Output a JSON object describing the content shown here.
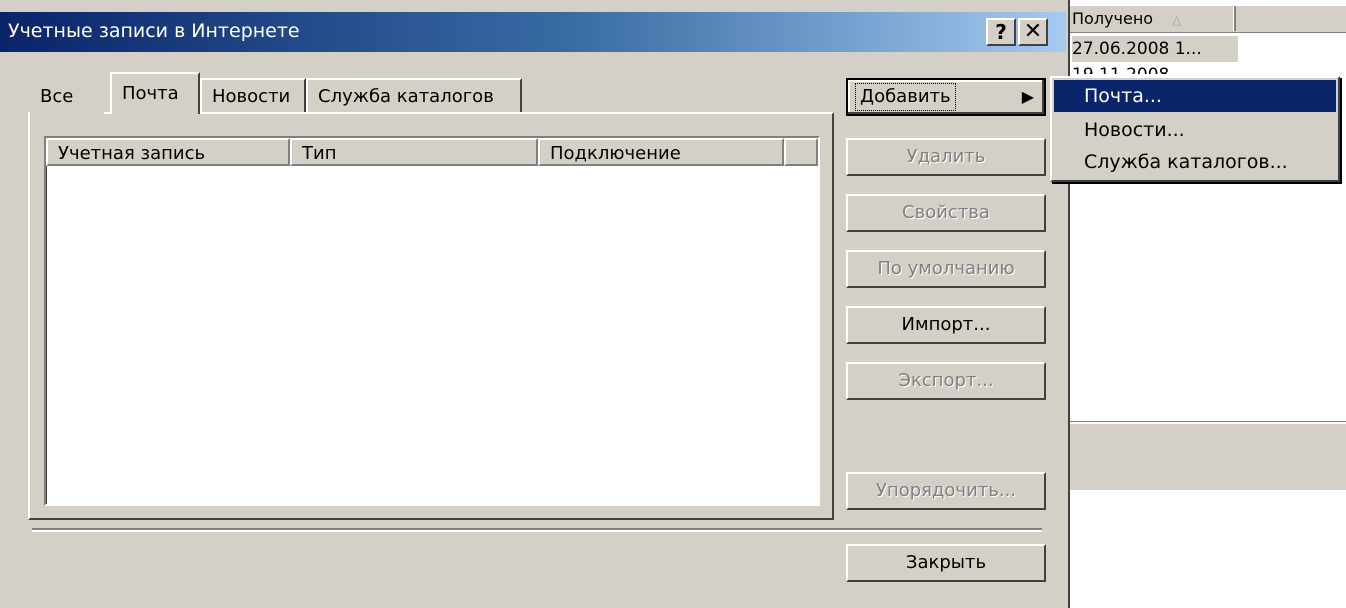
{
  "window": {
    "title": "Учетные записи в Интернете",
    "help_label": "?",
    "close_label": "✕"
  },
  "tabs": [
    {
      "label": "Все"
    },
    {
      "label": "Почта"
    },
    {
      "label": "Новости"
    },
    {
      "label": "Служба каталогов"
    }
  ],
  "list": {
    "columns": [
      "Учетная запись",
      "Тип",
      "Подключение",
      ""
    ]
  },
  "buttons": {
    "add": "Добавить",
    "delete": "Удалить",
    "properties": "Свойства",
    "default": "По умолчанию",
    "import": "Импорт...",
    "export": "Экспорт...",
    "order": "Упорядочить...",
    "close": "Закрыть"
  },
  "menu": {
    "items": [
      "Почта...",
      "Новости...",
      "Служба каталогов..."
    ]
  },
  "background_app": {
    "column_header": "Получено",
    "rows": [
      "27.06.2008 1...",
      "19.11.2008"
    ]
  },
  "icons": {
    "submenu_arrow": "▶",
    "sort": "△"
  }
}
